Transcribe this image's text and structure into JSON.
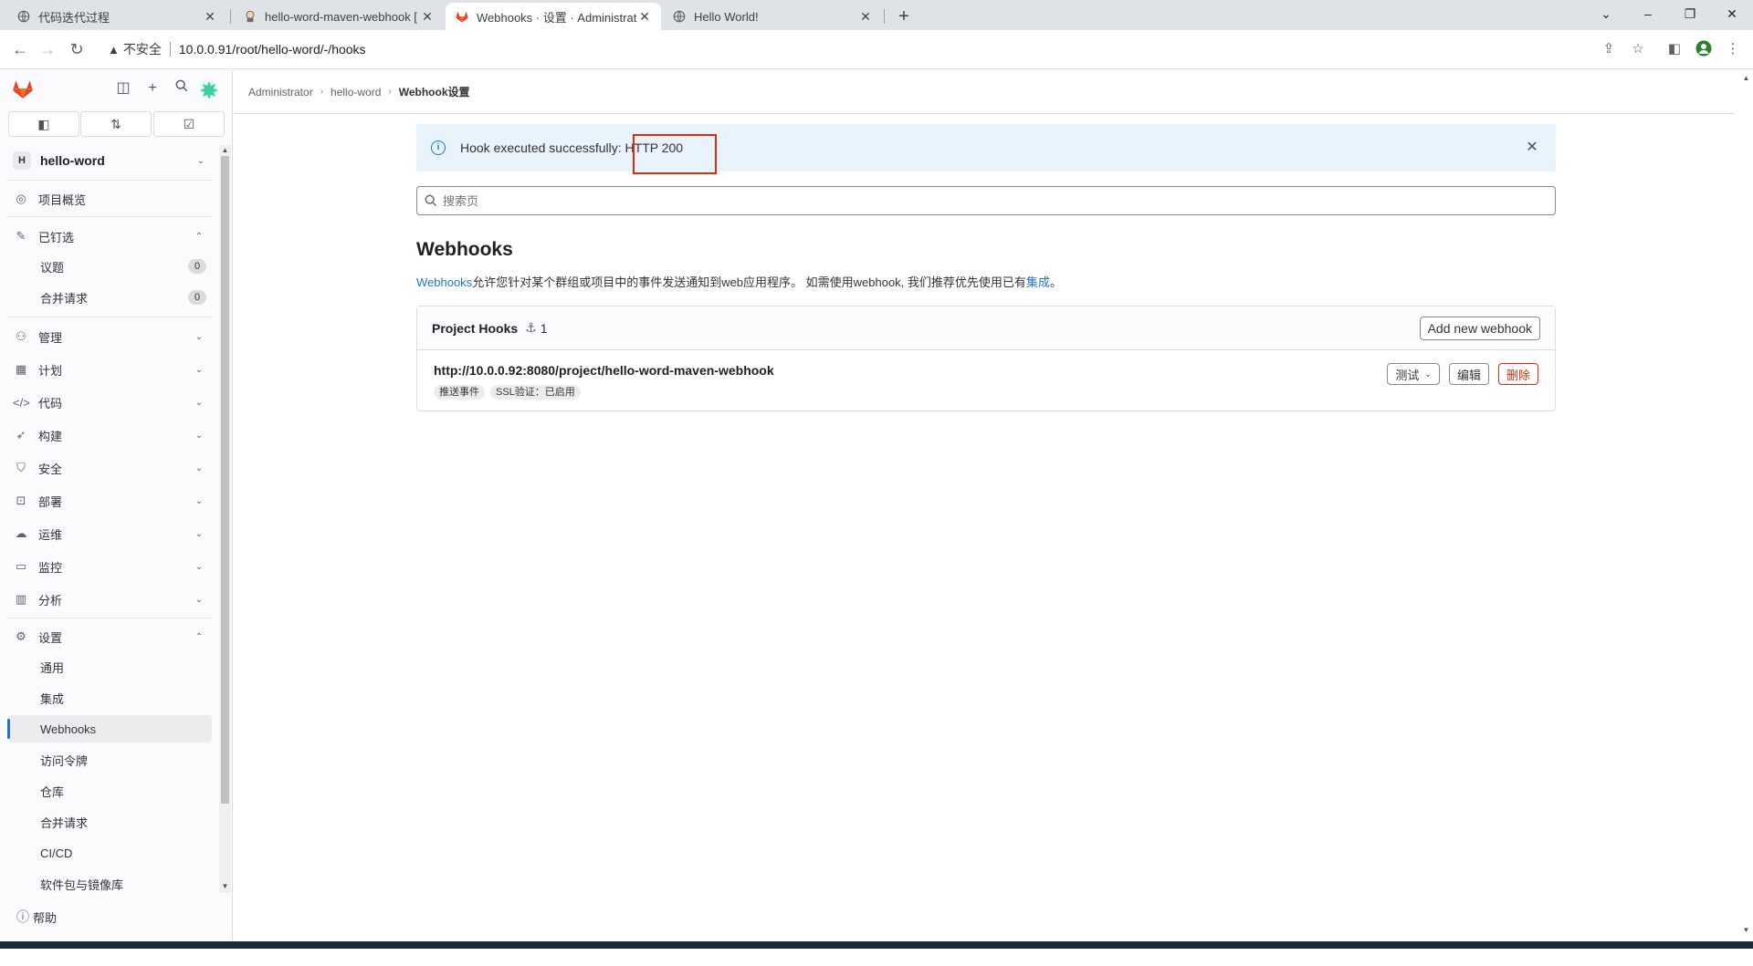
{
  "browser": {
    "tabs": [
      {
        "title": "代码迭代过程",
        "icon": "globe-icon",
        "active": false
      },
      {
        "title": "hello-word-maven-webhook [",
        "icon": "jenkins-icon",
        "active": false
      },
      {
        "title": "Webhooks · 设置 · Administrat",
        "icon": "gitlab-icon",
        "active": true
      },
      {
        "title": "Hello World!",
        "icon": "globe-icon",
        "active": false
      }
    ],
    "new_tab": "+",
    "security_label": "不安全",
    "url": "10.0.0.91/root/hello-word/-/hooks"
  },
  "sidebar": {
    "quick_actions": [
      "issues-icon",
      "merge-request-icon",
      "todo-icon"
    ],
    "project": {
      "avatar": "H",
      "name": "hello-word"
    },
    "items": [
      {
        "label": "项目概览",
        "icon": "project-icon",
        "expandable": false
      },
      {
        "label": "已钉选",
        "icon": "pin-icon",
        "expanded": true,
        "children": [
          {
            "label": "议题",
            "count": "0"
          },
          {
            "label": "合并请求",
            "count": "0"
          }
        ]
      },
      {
        "label": "管理",
        "icon": "users-icon"
      },
      {
        "label": "计划",
        "icon": "calendar-icon"
      },
      {
        "label": "代码",
        "icon": "code-icon"
      },
      {
        "label": "构建",
        "icon": "rocket-icon"
      },
      {
        "label": "安全",
        "icon": "shield-icon"
      },
      {
        "label": "部署",
        "icon": "deploy-icon"
      },
      {
        "label": "运维",
        "icon": "cloud-icon"
      },
      {
        "label": "监控",
        "icon": "monitor-icon"
      },
      {
        "label": "分析",
        "icon": "chart-icon"
      },
      {
        "label": "设置",
        "icon": "gear-icon",
        "expanded": true,
        "children": [
          {
            "label": "通用"
          },
          {
            "label": "集成"
          },
          {
            "label": "Webhooks",
            "active": true
          },
          {
            "label": "访问令牌"
          },
          {
            "label": "仓库"
          },
          {
            "label": "合并请求"
          },
          {
            "label": "CI/CD"
          },
          {
            "label": "软件包与镜像库"
          }
        ]
      }
    ],
    "help": "帮助"
  },
  "breadcrumb": [
    "Administrator",
    "hello-word",
    "Webhook设置"
  ],
  "alert": {
    "message_prefix": "Hook executed successfully: ",
    "message_status": "HTTP 200"
  },
  "search": {
    "placeholder": "搜索页"
  },
  "page": {
    "title": "Webhooks",
    "desc_link": "Webhooks",
    "desc_text": "允许您针对某个群组或项目中的事件发送通知到web应用程序。 如需使用webhook, 我们推荐优先使用已有",
    "desc_link2": "集成",
    "desc_end": "。"
  },
  "project_hooks": {
    "title": "Project Hooks",
    "count": "1",
    "add_button": "Add new webhook",
    "hooks": [
      {
        "url": "http://10.0.0.92:8080/project/hello-word-maven-webhook",
        "badges": [
          "推送事件",
          "SSL验证：已启用"
        ],
        "test_label": "测试",
        "edit_label": "编辑",
        "delete_label": "删除"
      }
    ]
  },
  "colors": {
    "accent": "#1f75cb",
    "danger": "#dd2b0e",
    "alert_bg": "#e9f3fc",
    "highlight": "#dd2b0e"
  }
}
